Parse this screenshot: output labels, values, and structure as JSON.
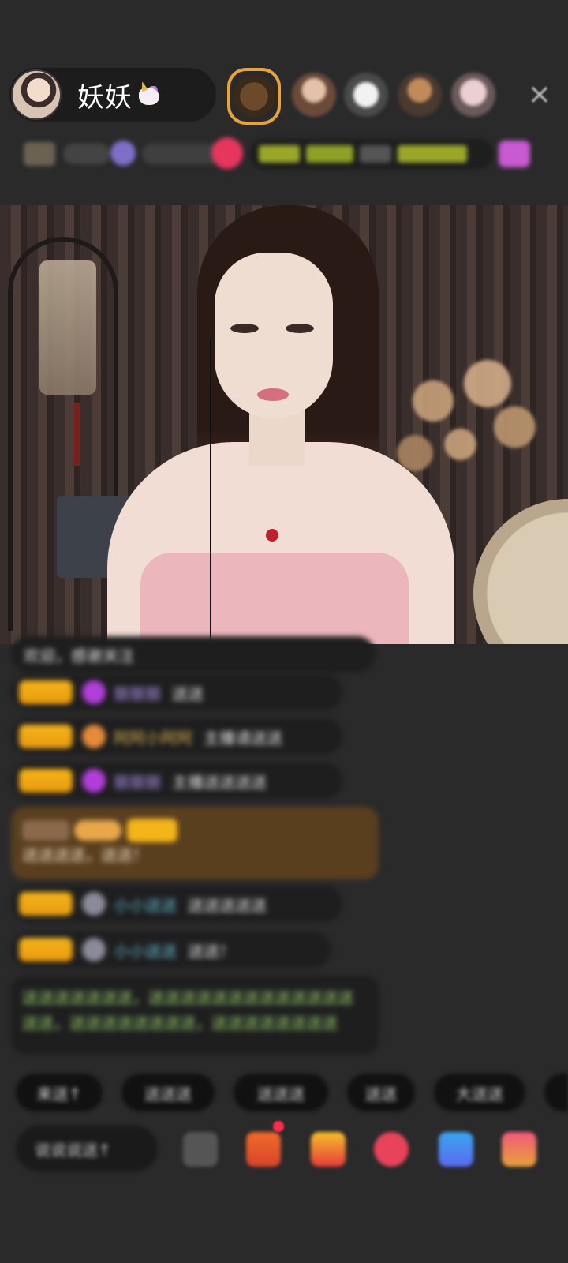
{
  "host": {
    "name": "妖妖",
    "name_emoji": "unicorn-emoji"
  },
  "header": {
    "close_icon": "×"
  },
  "chat": {
    "messages": [
      {
        "kind": "system-line",
        "text": "欢迎，感谢关注"
      },
      {
        "kind": "gift",
        "user": "丽丽丽",
        "text": "送送"
      },
      {
        "kind": "gift",
        "user": "阿阿小阿阿",
        "text": "主播请送送"
      },
      {
        "kind": "gift",
        "user": "丽丽丽",
        "text": "主播送送送送"
      },
      {
        "kind": "highlight",
        "text": "送送送送，送送！"
      },
      {
        "kind": "gift",
        "user": "小小送送",
        "text": "送送送送送"
      },
      {
        "kind": "gift",
        "user": "小小送送",
        "text": "送送！"
      },
      {
        "kind": "notice",
        "text": "送送送送送送送，送送送送送送送送送送送送送送送，送送送送送送送送，送送送送送送送送"
      }
    ]
  },
  "quick_replies": [
    "来送↑",
    "送送送",
    "送送送",
    "送送",
    "大送送"
  ],
  "bottom_bar": {
    "input_placeholder": "说说说送↑",
    "tools": [
      "more-icon",
      "gift-box-icon",
      "treasure-icon",
      "heart-gift-icon",
      "game-icon",
      "gift-icon"
    ]
  },
  "colors": {
    "background": "#2a2a2b",
    "badge_gold": "#f4b41a",
    "accent_pink": "#ff2d4a",
    "highlight_brown": "#5a3f1f",
    "notice_green": "#9ad06a"
  }
}
